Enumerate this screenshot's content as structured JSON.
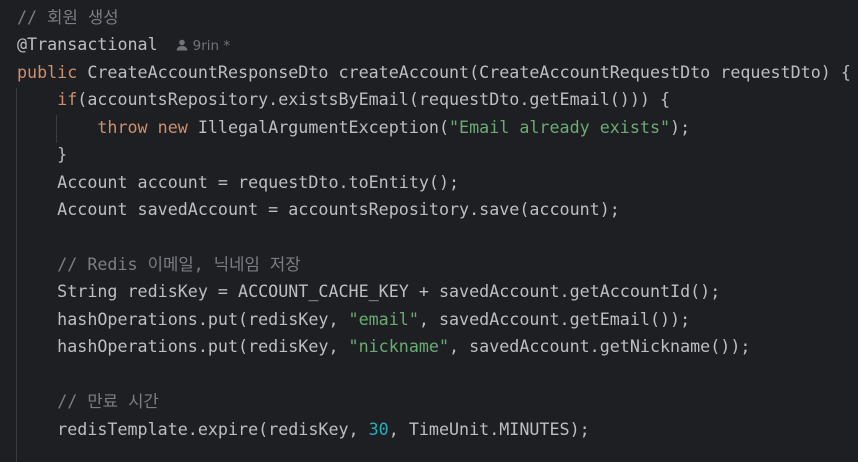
{
  "colors": {
    "background": "#1e1f22",
    "text": "#bcbec4",
    "keyword": "#cf8e6d",
    "string": "#6aab73",
    "number": "#2aacb8",
    "comment": "#7a7e85"
  },
  "author_hint": {
    "icon": "user-icon",
    "text": "9rin *"
  },
  "lines": [
    [
      [
        "cm",
        "// 회원 생성"
      ]
    ],
    [
      [
        "an",
        "@Transactional"
      ]
    ],
    [
      [
        "kw",
        "public "
      ],
      [
        "",
        "CreateAccountResponseDto createAccount(CreateAccountRequestDto requestDto) {"
      ]
    ],
    [
      [
        "",
        "    "
      ],
      [
        "kw",
        "if"
      ],
      [
        "",
        "(accountsRepository.existsByEmail(requestDto.getEmail())) {"
      ]
    ],
    [
      [
        "",
        "        "
      ],
      [
        "kw",
        "throw new "
      ],
      [
        "",
        "IllegalArgumentException("
      ],
      [
        "str",
        "\"Email already exists\""
      ],
      [
        "",
        ");"
      ]
    ],
    [
      [
        "",
        "    }"
      ]
    ],
    [
      [
        "",
        "    Account account = requestDto.toEntity();"
      ]
    ],
    [
      [
        "",
        "    Account savedAccount = accountsRepository.save(account);"
      ]
    ],
    [],
    [
      [
        "",
        "    "
      ],
      [
        "cm",
        "// Redis 이메일, 닉네임 저장"
      ]
    ],
    [
      [
        "",
        "    String redisKey = ACCOUNT_CACHE_KEY + savedAccount.getAccountId();"
      ]
    ],
    [
      [
        "",
        "    hashOperations.put(redisKey, "
      ],
      [
        "str",
        "\"email\""
      ],
      [
        "",
        ", savedAccount.getEmail());"
      ]
    ],
    [
      [
        "",
        "    hashOperations.put(redisKey, "
      ],
      [
        "str",
        "\"nickname\""
      ],
      [
        "",
        ", savedAccount.getNickname());"
      ]
    ],
    [],
    [
      [
        "",
        "    "
      ],
      [
        "cm",
        "// 만료 시간"
      ]
    ],
    [
      [
        "",
        "    redisTemplate.expire(redisKey, "
      ],
      [
        "num",
        "30"
      ],
      [
        "",
        ", TimeUnit.MINUTES);"
      ]
    ]
  ]
}
